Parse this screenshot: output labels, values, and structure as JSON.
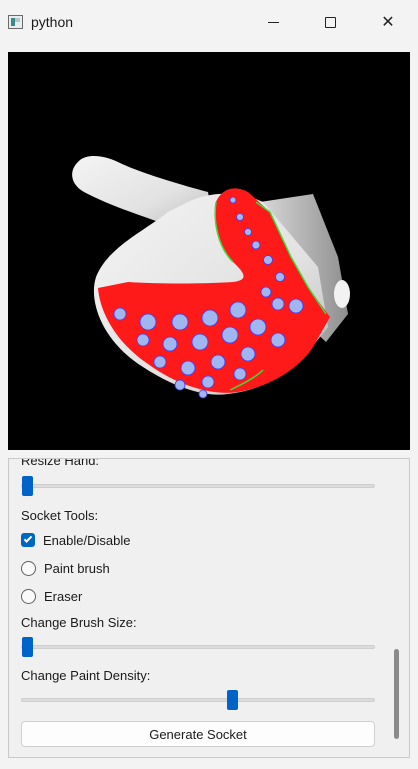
{
  "window": {
    "title": "python",
    "icon": "python-app-icon",
    "controls": {
      "minimize": "minimize-icon",
      "maximize": "maximize-icon",
      "close": "close-icon",
      "close_glyph": "✕"
    }
  },
  "viewport": {
    "background": "#000000",
    "model": "3d-hand-mesh",
    "paint_color": "#ff1a1a",
    "socket_dot_color": "#9fb6f0",
    "edge_color": "#3ddc3d"
  },
  "panel": {
    "resize_hand": {
      "label": "Resize Hand:",
      "value": 0.0
    },
    "socket_tools_label": "Socket Tools:",
    "enable": {
      "label": "Enable/Disable",
      "checked": true
    },
    "paint_brush": {
      "label": "Paint brush",
      "selected": false
    },
    "eraser": {
      "label": "Eraser",
      "selected": false
    },
    "brush_size": {
      "label": "Change Brush Size:",
      "value": 0.0
    },
    "paint_density": {
      "label": "Change Paint Density:",
      "value": 0.6
    },
    "generate_button": "Generate Socket"
  },
  "colors": {
    "accent": "#0067c0",
    "slider_handle": "#0063c7"
  }
}
